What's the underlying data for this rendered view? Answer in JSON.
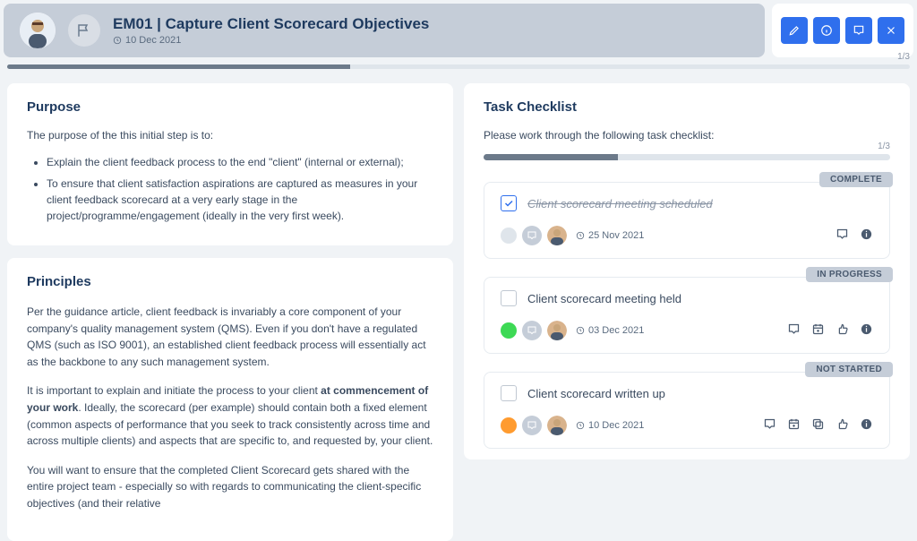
{
  "header": {
    "title": "EM01 | Capture Client Scorecard Objectives",
    "date": "10 Dec 2021",
    "progress": "1/3"
  },
  "purpose": {
    "heading": "Purpose",
    "intro": "The purpose of the this initial step is to:",
    "bullets": [
      "Explain the client feedback process to the end \"client\" (internal or external);",
      "To ensure that client satisfaction aspirations are captured as measures in your client feedback scorecard at a very early stage in the project/programme/engagement (ideally in the very first week)."
    ]
  },
  "principles": {
    "heading": "Principles",
    "p1": "Per the guidance article, client feedback is invariably a core component of your company's quality management system (QMS). Even if you don't have a regulated QMS (such as ISO 9001), an established client feedback process will essentially act as the backbone to any such management system.",
    "p2_a": "It is important to explain and initiate the process to your client ",
    "p2_bold": "at commencement of your work",
    "p2_b": ". Ideally, the scorecard (per example) should contain both a fixed element (common aspects of performance that you seek to track consistently across time and across multiple clients) and aspects that are specific to, and requested by, your client.",
    "p3": "You will want to ensure that the completed Client Scorecard gets shared with the entire project team - especially so with regards to communicating the client-specific objectives (and their relative"
  },
  "checklist": {
    "heading": "Task Checklist",
    "intro": "Please work through the following task checklist:",
    "progress": "1/3",
    "statuses": {
      "complete": "COMPLETE",
      "in_progress": "IN PROGRESS",
      "not_started": "NOT STARTED"
    },
    "tasks": [
      {
        "title": "Client scorecard meeting scheduled",
        "date": "25 Nov 2021"
      },
      {
        "title": "Client scorecard meeting held",
        "date": "03 Dec 2021"
      },
      {
        "title": "Client scorecard written up",
        "date": "10 Dec 2021"
      }
    ]
  }
}
